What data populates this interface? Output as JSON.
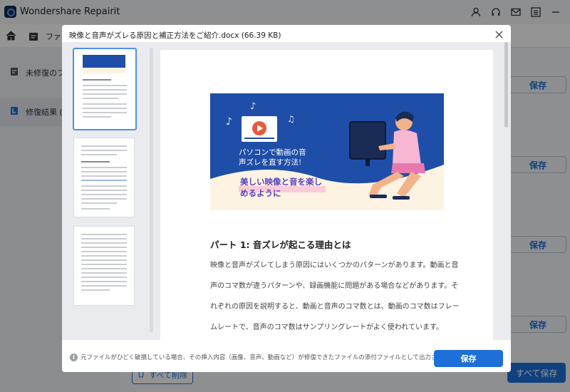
{
  "app": {
    "title": "Wondershare Repairit"
  },
  "window_icons": [
    "user-icon",
    "headset-icon",
    "mail-icon",
    "menu-icon",
    "minimize-icon"
  ],
  "nav": {
    "breadcrumb_partial": "ファイ"
  },
  "sidebar": {
    "items": [
      {
        "label": "未修復のファ",
        "icon": "file-icon"
      },
      {
        "label": "修復結果 (",
        "icon": "result-icon"
      }
    ]
  },
  "rows": {
    "save_label": "保存"
  },
  "bottom": {
    "delete_all": "すべて削除",
    "save_all": "すべて保存"
  },
  "dialog": {
    "title": "映像と音声がズレる原因と補正方法をご紹介.docx (66.39  KB)",
    "banner": {
      "line1": "パソコンで動画の音",
      "line2": "声ズレを直す方法!",
      "line3": "美しい映像と音を楽し",
      "line4": "めるように",
      "colors": {
        "bg": "#1f4ea8",
        "cream": "#fdf3e3",
        "accent": "#f7b6d2"
      }
    },
    "heading": "パート 1:  音ズレが起こる理由とは",
    "paragraph": [
      "映像と音声がズレてしまう原因にはいくつかのパターンがあります。動画と音",
      "声のコマ数が違うパターンや、録画機能に問題がある場合などがあります。そ",
      "れぞれの原因を説明すると、動画と音声のコマ数とは、動画のコマ数はフレー",
      "ムレートで、音声のコマ数はサンプリングレートがよく使われています。"
    ],
    "footer_note": "元ファイルがひどく破損している場合、その挿入内容（画像、音声、動画など）が修復できたファイルの添付ファイルとして出力されます。",
    "save_label": "保存"
  },
  "colors": {
    "primary": "#1e6fd9"
  }
}
